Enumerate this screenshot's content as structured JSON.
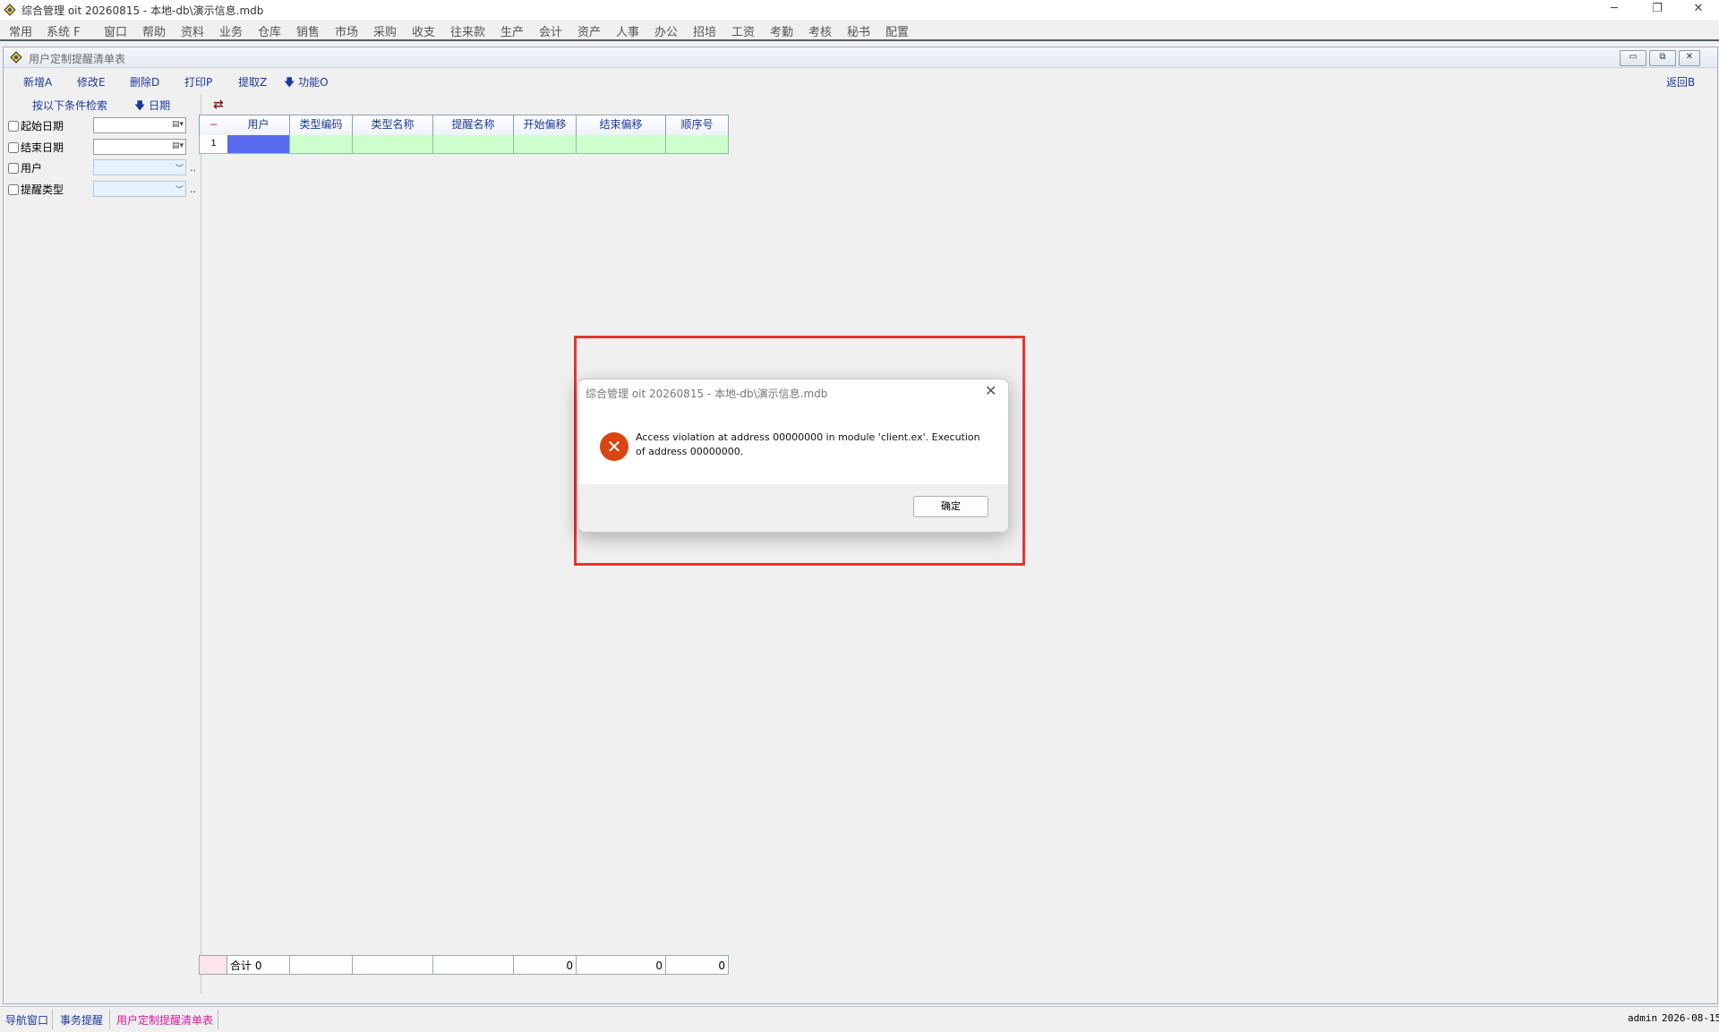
{
  "app": {
    "title": "综合管理 oit 20260815 - 本地-db\\演示信息.mdb",
    "window_buttons": {
      "minimize": "─",
      "restore": "❐",
      "close": "✕"
    }
  },
  "menubar": [
    "常用",
    "系统 F",
    "窗口",
    "帮助",
    "资料",
    "业务",
    "仓库",
    "销售",
    "市场",
    "采购",
    "收支",
    "往来款",
    "生产",
    "会计",
    "资产",
    "人事",
    "办公",
    "招培",
    "工资",
    "考勤",
    "考核",
    "秘书",
    "配置"
  ],
  "inner_window": {
    "title": "用户定制提醒清单表",
    "buttons": {
      "minimize": "▭",
      "restore": "⧉",
      "close": "✕"
    }
  },
  "toolbar": {
    "add": "新增A",
    "edit": "修改E",
    "delete": "删除D",
    "print": "打印P",
    "fetch": "提取Z",
    "func": "功能O",
    "back": "返回B"
  },
  "filter": {
    "search_label": "按以下条件检索",
    "date_label": "日期",
    "rows": [
      {
        "label": "起始日期",
        "type": "date"
      },
      {
        "label": "结束日期",
        "type": "date"
      },
      {
        "label": "用户",
        "type": "combo"
      },
      {
        "label": "提醒类型",
        "type": "combo"
      }
    ]
  },
  "grid": {
    "columns": [
      "用户",
      "类型编码",
      "类型名称",
      "提醒名称",
      "开始偏移",
      "结束偏移",
      "顺序号"
    ],
    "rows": [
      {
        "index": "1",
        "cells": [
          "",
          "",
          "",
          "",
          "",
          "",
          ""
        ]
      }
    ],
    "footer": {
      "label": "合计",
      "count": "0",
      "values": [
        "",
        "",
        "",
        "",
        "0",
        "0",
        "0"
      ]
    }
  },
  "dialog": {
    "title": "综合管理 oit 20260815 - 本地-db\\演示信息.mdb",
    "message": "Access violation at address 00000000 in module 'client.ex'. Execution of address 00000000.",
    "ok_label": "确定",
    "icon": "error-icon"
  },
  "statusbar": {
    "tabs": [
      "导航窗口",
      "事务提醒",
      "用户定制提醒清单表"
    ],
    "user": "admin",
    "date": "2026-08-15"
  },
  "colors": {
    "accent": "#1a3a9a",
    "grid_row": "#ccffcc",
    "selected_cell": "#5a6af0",
    "error": "#d84510",
    "highlight_border": "#e53434"
  }
}
